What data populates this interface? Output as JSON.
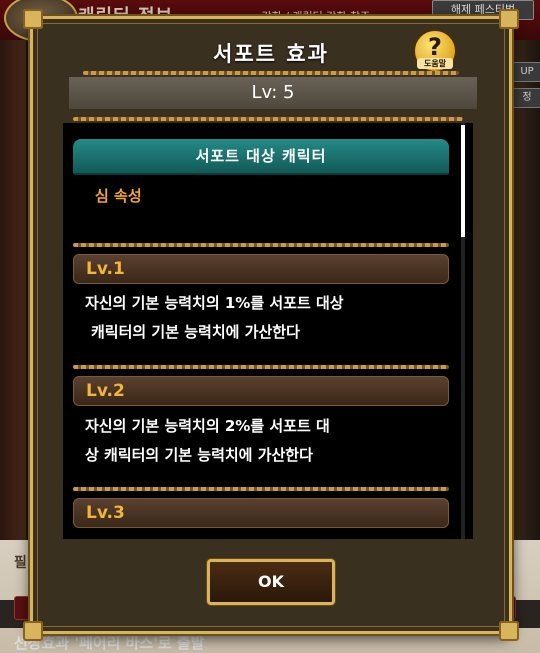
{
  "background": {
    "screen_title": "캐릭터 정보",
    "subtitle": "·강화 / 캐릭터 강화 참조",
    "top_button": "해제 페스티벌",
    "right_tag_1": "UP",
    "right_tag_2": "정",
    "bottom_label": "필",
    "bottom_text": "선장효과  '페어리 바스'로 출발"
  },
  "dialog": {
    "title": "서포트 효과",
    "help_label": "도움말",
    "level": "Lv: 5",
    "target_header": "서포트 대상 캐릭터",
    "attribute": "심 속성",
    "levels": [
      {
        "label": "Lv.1",
        "description_line1": "자신의 기본 능력치의 1%를 서포트 대상",
        "description_line2": "캐릭터의 기본 능력치에 가산한다"
      },
      {
        "label": "Lv.2",
        "description_line1": "자신의 기본 능력치의 2%를 서포트 대",
        "description_line2": "상 캐릭터의 기본 능력치에 가산한다"
      },
      {
        "label": "Lv.3"
      }
    ],
    "ok_label": "OK"
  }
}
